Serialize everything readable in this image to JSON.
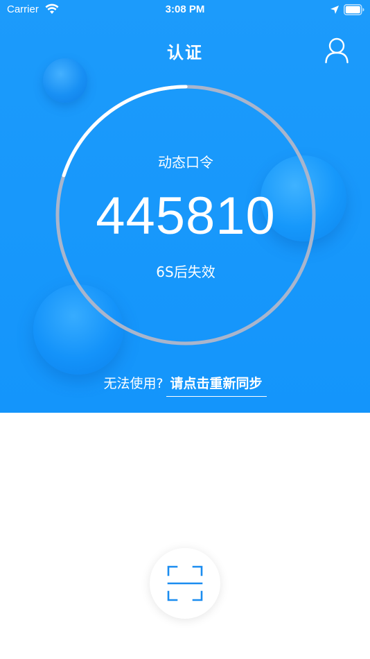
{
  "status_bar": {
    "carrier": "Carrier",
    "time": "3:08 PM",
    "icons": [
      "wifi-icon",
      "location-arrow-icon",
      "battery-icon"
    ]
  },
  "nav": {
    "title": "认证",
    "right_icon": "user-profile-icon"
  },
  "otp": {
    "label": "动态口令",
    "code": "445810",
    "expiry": "6S后失效",
    "remaining_fraction": 0.2
  },
  "resync": {
    "prefix": "无法使用?",
    "link": "请点击重新同步"
  },
  "scan": {
    "icon": "scan-qr-icon"
  },
  "colors": {
    "primary": "#1a98fb",
    "ring_track": "#a9b5cc",
    "ring_progress": "#ffffff",
    "scan_accent": "#1a8cf0"
  }
}
